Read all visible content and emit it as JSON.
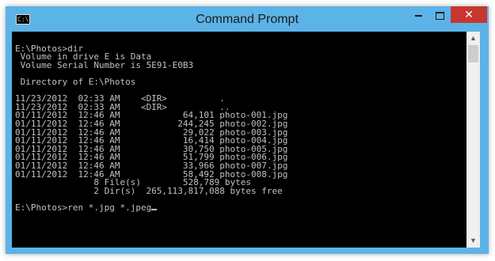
{
  "window": {
    "title": "Command Prompt",
    "app_icon_text": "C:\\",
    "controls": {
      "minimize": "minimize",
      "maximize": "maximize",
      "close": "✕"
    }
  },
  "console": {
    "lines": [
      "",
      "E:\\Photos>dir",
      " Volume in drive E is Data",
      " Volume Serial Number is 5E91-E0B3",
      "",
      " Directory of E:\\Photos",
      "",
      "11/23/2012  02:33 AM    <DIR>          .",
      "11/23/2012  02:33 AM    <DIR>          ..",
      "01/11/2012  12:46 AM            64,101 photo-001.jpg",
      "01/11/2012  12:46 AM           244,245 photo-002.jpg",
      "01/11/2012  12:46 AM            29,022 photo-003.jpg",
      "01/11/2012  12:46 AM            16,414 photo-004.jpg",
      "01/11/2012  12:46 AM            30,750 photo-005.jpg",
      "01/11/2012  12:46 AM            51,799 photo-006.jpg",
      "01/11/2012  12:46 AM            33,966 photo-007.jpg",
      "01/11/2012  12:46 AM            58,492 photo-008.jpg",
      "               8 File(s)        528,789 bytes",
      "               2 Dir(s)  265,113,817,088 bytes free",
      ""
    ],
    "prompt_line": "E:\\Photos>ren *.jpg *.jpeg"
  },
  "colors": {
    "title_bar": "#5cb3e8",
    "close_button": "#c7372f",
    "console_bg": "#000000",
    "console_text": "#c0c0c0"
  }
}
